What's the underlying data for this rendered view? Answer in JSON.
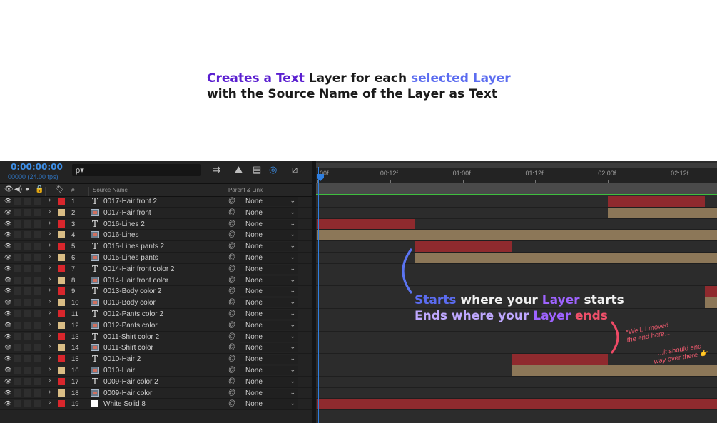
{
  "headline": {
    "line1_a": "Creates a Text",
    "line1_b": " Layer for each ",
    "line1_c": "selected Layer",
    "line2": "with the Source Name of the Layer as Text"
  },
  "panel": {
    "timecode": "0:00:00:00",
    "fps": "00000 (24.00 fps)",
    "search_icon": "ρ▾",
    "columns": {
      "number": "#",
      "source_name": "Source Name",
      "parent_link": "Parent & Link"
    }
  },
  "layers": [
    {
      "num": "1",
      "type": "text",
      "name": "0017-Hair front 2",
      "label": "red",
      "parent": "None"
    },
    {
      "num": "2",
      "type": "comp",
      "name": "0017-Hair front",
      "label": "sand",
      "parent": "None"
    },
    {
      "num": "3",
      "type": "text",
      "name": "0016-Lines 2",
      "label": "red",
      "parent": "None"
    },
    {
      "num": "4",
      "type": "comp",
      "name": "0016-Lines",
      "label": "sand",
      "parent": "None"
    },
    {
      "num": "5",
      "type": "text",
      "name": "0015-Lines pants 2",
      "label": "red",
      "parent": "None"
    },
    {
      "num": "6",
      "type": "comp",
      "name": "0015-Lines pants",
      "label": "sand",
      "parent": "None"
    },
    {
      "num": "7",
      "type": "text",
      "name": "0014-Hair front color 2",
      "label": "red",
      "parent": "None"
    },
    {
      "num": "8",
      "type": "comp",
      "name": "0014-Hair front color",
      "label": "sand",
      "parent": "None"
    },
    {
      "num": "9",
      "type": "text",
      "name": "0013-Body color 2",
      "label": "red",
      "parent": "None"
    },
    {
      "num": "10",
      "type": "comp",
      "name": "0013-Body color",
      "label": "sand",
      "parent": "None"
    },
    {
      "num": "11",
      "type": "text",
      "name": "0012-Pants color 2",
      "label": "red",
      "parent": "None"
    },
    {
      "num": "12",
      "type": "comp",
      "name": "0012-Pants color",
      "label": "sand",
      "parent": "None"
    },
    {
      "num": "13",
      "type": "text",
      "name": "0011-Shirt color 2",
      "label": "red",
      "parent": "None"
    },
    {
      "num": "14",
      "type": "comp",
      "name": "0011-Shirt color",
      "label": "sand",
      "parent": "None"
    },
    {
      "num": "15",
      "type": "text",
      "name": "0010-Hair 2",
      "label": "red",
      "parent": "None"
    },
    {
      "num": "16",
      "type": "comp",
      "name": "0010-Hair",
      "label": "sand",
      "parent": "None"
    },
    {
      "num": "17",
      "type": "text",
      "name": "0009-Hair color 2",
      "label": "red",
      "parent": "None"
    },
    {
      "num": "18",
      "type": "comp",
      "name": "0009-Hair color",
      "label": "sand",
      "parent": "None"
    },
    {
      "num": "19",
      "type": "solid",
      "name": "White Solid 8",
      "label": "red",
      "parent": "None"
    }
  ],
  "timeline": {
    "ruler_labels": [
      "00f",
      "00:12f",
      "01:00f",
      "01:12f",
      "02:00f",
      "02:12f"
    ],
    "ruler_frames": [
      0,
      12,
      24,
      36,
      48,
      60
    ],
    "visible_frames": 66,
    "bars": [
      {
        "layer": 1,
        "start": 48,
        "end": 64,
        "color": "red"
      },
      {
        "layer": 2,
        "start": 48,
        "end": 66,
        "color": "sand"
      },
      {
        "layer": 3,
        "start": 0,
        "end": 16,
        "color": "red"
      },
      {
        "layer": 4,
        "start": 0,
        "end": 66,
        "color": "sand"
      },
      {
        "layer": 5,
        "start": 16,
        "end": 32,
        "color": "red"
      },
      {
        "layer": 6,
        "start": 16,
        "end": 66,
        "color": "sand"
      },
      {
        "layer": 9,
        "start": 64,
        "end": 66,
        "color": "red"
      },
      {
        "layer": 10,
        "start": 64,
        "end": 66,
        "color": "sand"
      },
      {
        "layer": 15,
        "start": 32,
        "end": 48,
        "color": "red"
      },
      {
        "layer": 16,
        "start": 32,
        "end": 66,
        "color": "sand"
      },
      {
        "layer": 19,
        "start": 0,
        "end": 66,
        "color": "red"
      }
    ]
  },
  "colors": {
    "red": "#8f2a2e",
    "sand": "#8c7758",
    "label_red": "#d9262c",
    "label_sand": "#d9bd85",
    "accent_blue": "#3d8ee6"
  },
  "annotation": {
    "l1_a": "Starts",
    "l1_b": " where your ",
    "l1_c": "Layer",
    "l1_d": " starts",
    "l2_a": "Ends where your ",
    "l2_b": "Layer",
    "l2_c": " ends",
    "note1_l1": "*Well, I moved",
    "note1_l2": "the end here...",
    "note2_l1": "...it should end",
    "note2_l2": "way over there",
    "note2_emoji": "👉"
  }
}
